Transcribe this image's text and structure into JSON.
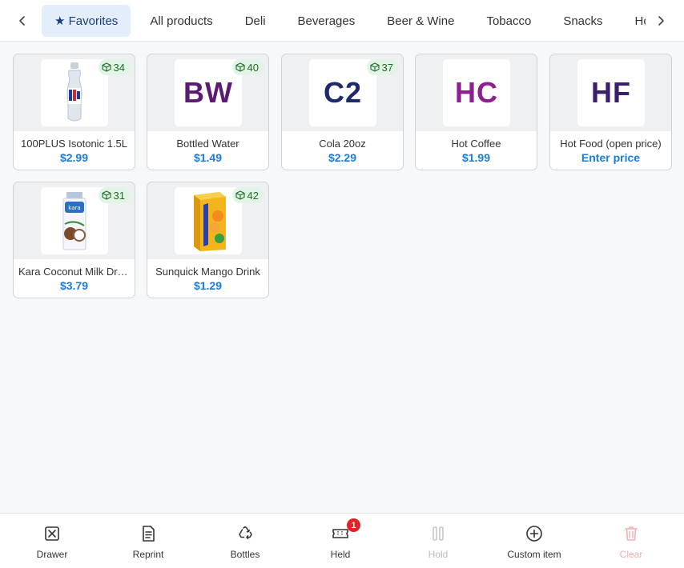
{
  "categories": {
    "tabs": [
      {
        "label": "★ Favorites",
        "active": true
      },
      {
        "label": "All products",
        "active": false
      },
      {
        "label": "Deli",
        "active": false
      },
      {
        "label": "Beverages",
        "active": false
      },
      {
        "label": "Beer & Wine",
        "active": false
      },
      {
        "label": "Tobacco",
        "active": false
      },
      {
        "label": "Snacks",
        "active": false
      },
      {
        "label": "Househ",
        "active": false
      }
    ],
    "prev_icon": "chevron-left-icon",
    "next_icon": "chevron-right-icon"
  },
  "products": [
    {
      "name": "100PLUS Isotonic 1.5L",
      "price": "$2.99",
      "stock": "34",
      "image": "bottle-photo"
    },
    {
      "name": "Bottled Water",
      "price": "$1.49",
      "stock": "40",
      "abbr": "BW",
      "abbr_color": "#5b1a73"
    },
    {
      "name": "Cola 20oz",
      "price": "$2.29",
      "stock": "37",
      "abbr": "C2",
      "abbr_color": "#1f2a6b"
    },
    {
      "name": "Hot Coffee",
      "price": "$1.99",
      "abbr": "HC",
      "abbr_color": "#8e1f8e"
    },
    {
      "name": "Hot Food (open price)",
      "price": "Enter price",
      "abbr": "HF",
      "abbr_color": "#3b1f6b"
    },
    {
      "name": "Kara Coconut Milk Drink",
      "price": "$3.79",
      "stock": "31",
      "image": "carton-photo"
    },
    {
      "name": "Sunquick Mango Drink",
      "price": "$1.29",
      "stock": "42",
      "image": "juice-box-photo"
    }
  ],
  "toolbar": {
    "drawer": "Drawer",
    "reprint": "Reprint",
    "bottles": "Bottles",
    "held": "Held",
    "held_count": "1",
    "hold": "Hold",
    "custom_item": "Custom item",
    "clear": "Clear"
  },
  "colors": {
    "accent": "#1a7be0",
    "active_tab_bg": "#e3edfc",
    "stock_badge_bg": "#e2f4e5",
    "stock_badge_text": "#1f6b2a",
    "notification": "#e02424"
  }
}
